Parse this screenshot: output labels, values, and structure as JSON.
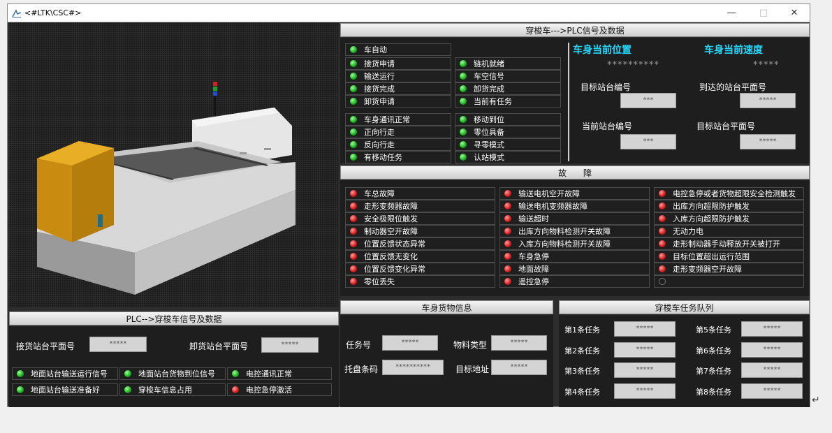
{
  "window": {
    "title": "<#LTK\\CSC#>",
    "minimize": "—",
    "maximize": "□",
    "close": "✕"
  },
  "shuttle_to_plc": {
    "title": "穿梭车--->PLC信号及数据",
    "col1": [
      {
        "label": "车自动",
        "state": "green"
      },
      {
        "label": "接货申请",
        "state": "green"
      },
      {
        "label": "输送运行",
        "state": "green"
      },
      {
        "label": "接货完成",
        "state": "green"
      },
      {
        "label": "卸货申请",
        "state": "green"
      },
      {
        "label": "车身通讯正常",
        "state": "green"
      },
      {
        "label": "正向行走",
        "state": "green"
      },
      {
        "label": "反向行走",
        "state": "green"
      },
      {
        "label": "有移动任务",
        "state": "green"
      }
    ],
    "col2": [
      {
        "label": "链机就绪",
        "state": "green"
      },
      {
        "label": "车空信号",
        "state": "green"
      },
      {
        "label": "卸货完成",
        "state": "green"
      },
      {
        "label": "当前有任务",
        "state": "green"
      },
      {
        "label": "移动到位",
        "state": "green"
      },
      {
        "label": "零位具备",
        "state": "green"
      },
      {
        "label": "寻零模式",
        "state": "green"
      },
      {
        "label": "认站模式",
        "state": "green"
      }
    ],
    "position_title": "车身当前位置",
    "speed_title": "车身当前速度",
    "position_value": "**********",
    "speed_value": "*****",
    "target_station_label": "目标站台编号",
    "target_station_value": "***",
    "reached_level_label": "到达的站台平面号",
    "reached_level_value": "*****",
    "current_station_label": "当前站台编号",
    "current_station_value": "***",
    "target_level_label": "目标站台平面号",
    "target_level_value": "*****"
  },
  "faults": {
    "title": "故　　障",
    "col1": [
      "车总故障",
      "走形变频器故障",
      "安全极限位触发",
      "制动器空开故障",
      "位置反馈状态异常",
      "位置反馈无变化",
      "位置反馈变化异常",
      "零位丢失"
    ],
    "col2": [
      "输送电机空开故障",
      "输送电机变频器故障",
      "输送超时",
      "出库方向物料检测开关故障",
      "入库方向物料检测开关故障",
      "车身急停",
      "地面故障",
      "遥控急停"
    ],
    "col3": [
      "电控急停或者货物超限安全检测触发",
      "出库方向超限防护触发",
      "入库方向超限防护触发",
      "无动力电",
      "走形制动器手动释放开关被打开",
      "目标位置超出运行范围",
      "走形变频器空开故障",
      ""
    ]
  },
  "cargo": {
    "title": "车身货物信息",
    "task_label": "任务号",
    "task_value": "*****",
    "material_label": "物料类型",
    "material_value": "*****",
    "tray_label": "托盘条码",
    "tray_value": "**********",
    "dest_label": "目标地址",
    "dest_value": "*****"
  },
  "queue": {
    "title": "穿梭车任务队列",
    "items": [
      {
        "label": "第1条任务",
        "value": "*****"
      },
      {
        "label": "第2条任务",
        "value": "*****"
      },
      {
        "label": "第3条任务",
        "value": "*****"
      },
      {
        "label": "第4条任务",
        "value": "*****"
      },
      {
        "label": "第5条任务",
        "value": "*****"
      },
      {
        "label": "第6条任务",
        "value": "*****"
      },
      {
        "label": "第7条任务",
        "value": "*****"
      },
      {
        "label": "第8条任务",
        "value": "*****"
      }
    ]
  },
  "plc_to_shuttle": {
    "title": "PLC-->穿梭车信号及数据",
    "receive_label": "接货站台平面号",
    "receive_value": "*****",
    "unload_label": "卸货站台平面号",
    "unload_value": "*****",
    "signals": [
      {
        "label": "地面站台输送运行信号",
        "state": "green"
      },
      {
        "label": "地面站台货物到位信号",
        "state": "green"
      },
      {
        "label": "电控通讯正常",
        "state": "green"
      },
      {
        "label": "地面站台输送准备好",
        "state": "green"
      },
      {
        "label": "穿梭车信息占用",
        "state": "green"
      },
      {
        "label": "电控急停激活",
        "state": "red"
      }
    ]
  }
}
